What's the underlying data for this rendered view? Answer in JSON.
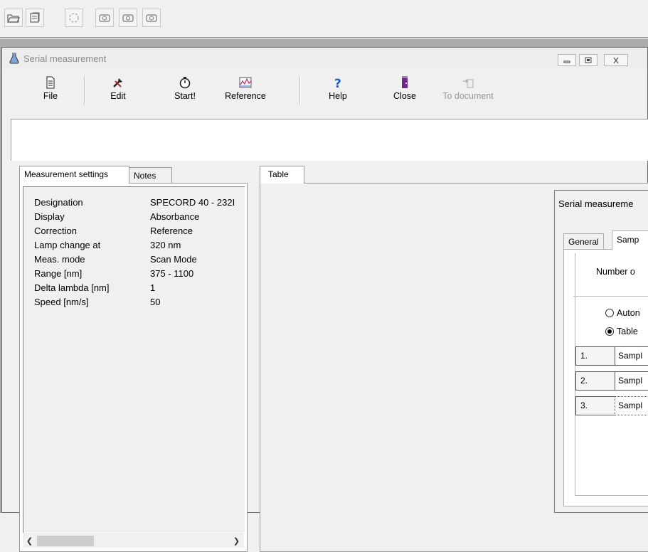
{
  "app_toolbar": {
    "buttons": [
      {
        "icon": "open-folder-icon"
      },
      {
        "icon": "database-icon"
      },
      {
        "icon": "cycle-icon"
      },
      {
        "icon": "sample-holder-icon"
      },
      {
        "icon": "sample-holder-icon"
      },
      {
        "icon": "sample-holder-icon"
      }
    ]
  },
  "window": {
    "title": "Serial measurement",
    "toolbar": {
      "file": "File",
      "edit": "Edit",
      "start": "Start!",
      "reference": "Reference",
      "help": "Help",
      "close": "Close",
      "to_document": "To document"
    }
  },
  "tabs": {
    "measurement_settings": "Measurement settings",
    "notes": "Notes",
    "table": "Table"
  },
  "settings": [
    {
      "key": "Designation",
      "value": "SPECORD 40 - 232I"
    },
    {
      "key": "Display",
      "value": "Absorbance"
    },
    {
      "key": "Correction",
      "value": "Reference"
    },
    {
      "key": "Lamp change at",
      "value": "320 nm"
    },
    {
      "key": "Meas. mode",
      "value": "Scan Mode"
    },
    {
      "key": "Range [nm]",
      "value": "375 - 1100"
    },
    {
      "key": "Delta lambda [nm]",
      "value": "1"
    },
    {
      "key": "Speed [nm/s]",
      "value": "50"
    }
  ],
  "dialog": {
    "title": "Serial measureme",
    "tabs": {
      "general": "General",
      "samples": "Samp"
    },
    "number_label": "Number o",
    "radio_auto": "Auton",
    "radio_table": "Table",
    "samples": [
      {
        "num": "1.",
        "name": "Sampl"
      },
      {
        "num": "2.",
        "name": "Sampl"
      },
      {
        "num": "3.",
        "name": "Sampl"
      }
    ]
  },
  "colors": {
    "mdi_background": "#aaaaaa",
    "help_icon": "#1e5fd6",
    "close_icon": "#6b2a8a"
  }
}
